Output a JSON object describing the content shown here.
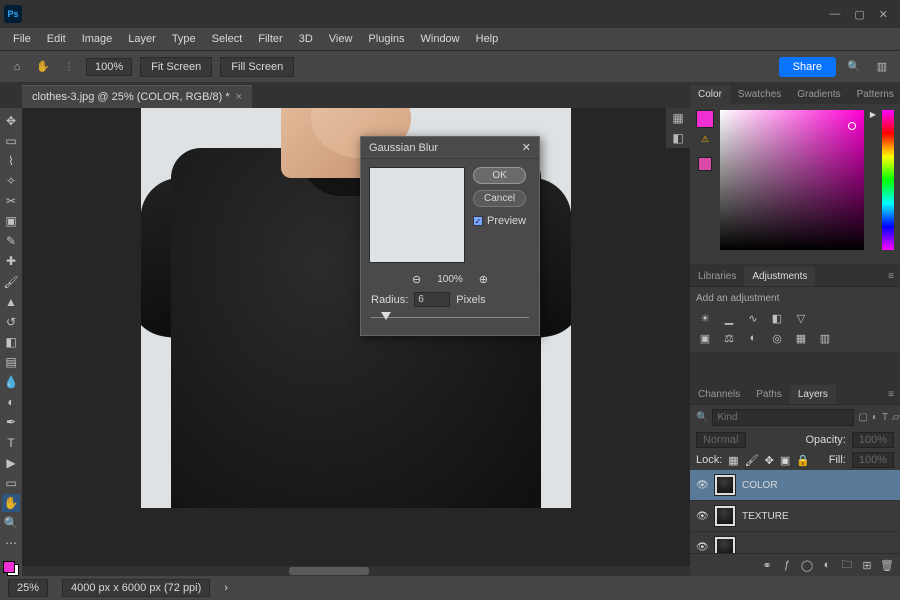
{
  "titlebar": {
    "app_logo": "Ps"
  },
  "menu": [
    "File",
    "Edit",
    "Image",
    "Layer",
    "Type",
    "Select",
    "Filter",
    "3D",
    "View",
    "Plugins",
    "Window",
    "Help"
  ],
  "optionsbar": {
    "zoom_value": "100%",
    "fit_screen": "Fit Screen",
    "fill_screen": "Fill Screen",
    "share": "Share"
  },
  "document_tab": {
    "title": "clothes-3.jpg @ 25% (COLOR, RGB/8) *"
  },
  "dialog": {
    "title": "Gaussian Blur",
    "ok": "OK",
    "cancel": "Cancel",
    "preview_label": "Preview",
    "preview_checked": true,
    "zoom_value": "100%",
    "radius_label": "Radius:",
    "radius_value": "6",
    "radius_unit": "Pixels"
  },
  "panels": {
    "color_tabs": [
      "Color",
      "Swatches",
      "Gradients",
      "Patterns"
    ],
    "lib_tabs": [
      "Libraries",
      "Adjustments"
    ],
    "adjustments_hint": "Add an adjustment",
    "layer_tabs": [
      "Channels",
      "Paths",
      "Layers"
    ],
    "layer_kind_placeholder": "Kind",
    "blend_mode": "Normal",
    "opacity_label": "Opacity:",
    "opacity_value": "100%",
    "lock_label": "Lock:",
    "fill_label": "Fill:",
    "fill_value": "100%",
    "layers": [
      {
        "name": "COLOR",
        "visible": true,
        "selected": true
      },
      {
        "name": "TEXTURE",
        "visible": true,
        "selected": false
      }
    ]
  },
  "status": {
    "zoom": "25%",
    "doc_info": "4000 px x 6000 px (72 ppi)"
  },
  "colors": {
    "foreground": "#ed2fd4"
  }
}
